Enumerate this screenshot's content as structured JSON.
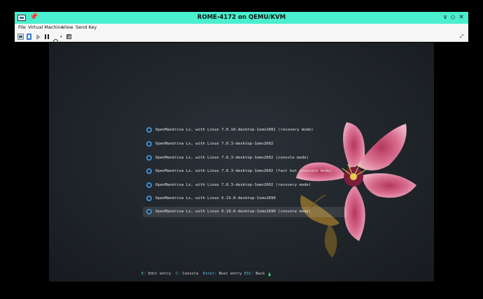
{
  "window": {
    "title": "ROME-4172 on QEMU/KVM"
  },
  "menu": [
    "File",
    "Virtual Machine",
    "View",
    "Send Key"
  ],
  "colors": {
    "titlebar": "#49efcf",
    "accent": "#3b8fd6",
    "key": "#5cc3e8"
  },
  "boot_entries": [
    "OpenMandriva Lx, with Linux 7.0.10-desktop-1omv2602 (recovery mode)",
    "OpenMandriva Lx, with Linux 7.0.3-desktop-1omv2602",
    "OpenMandriva Lx, with Linux 7.0.3-desktop-1omv2602 (console mode)",
    "OpenMandriva Lx, with Linux 7.0.3-desktop-1omv2602 (fast but insecure mode)",
    "OpenMandriva Lx, with Linux 7.0.3-desktop-1omv2602 (recovery mode)",
    "OpenMandriva Lx, with Linux 6.19.0-desktop-1omv2690",
    "OpenMandriva Lx, with Linux 6.19.0-desktop-1omv2690 (console mode)"
  ],
  "footer": {
    "edit_key": "E:",
    "edit_label": "Edit entry",
    "console_key": "C:",
    "console_label": "Console",
    "boot_key": "Enter:",
    "boot_label": "Boot entry",
    "back_key": "ESC:",
    "back_label": "Back"
  },
  "icons": {
    "title_app": "vm-screen-icon",
    "title_pin": "pin-icon",
    "win_minimize": "chevron-down-icon",
    "win_maximize": "diamond-icon",
    "win_close": "close-icon",
    "tb_console": "console-icon",
    "tb_details": "details-icon",
    "tb_run": "play-icon",
    "tb_pause": "pause-icon",
    "tb_power": "power-icon",
    "tb_snapshot": "snapshot-icon",
    "tb_fullscreen": "fullscreen-icon"
  }
}
